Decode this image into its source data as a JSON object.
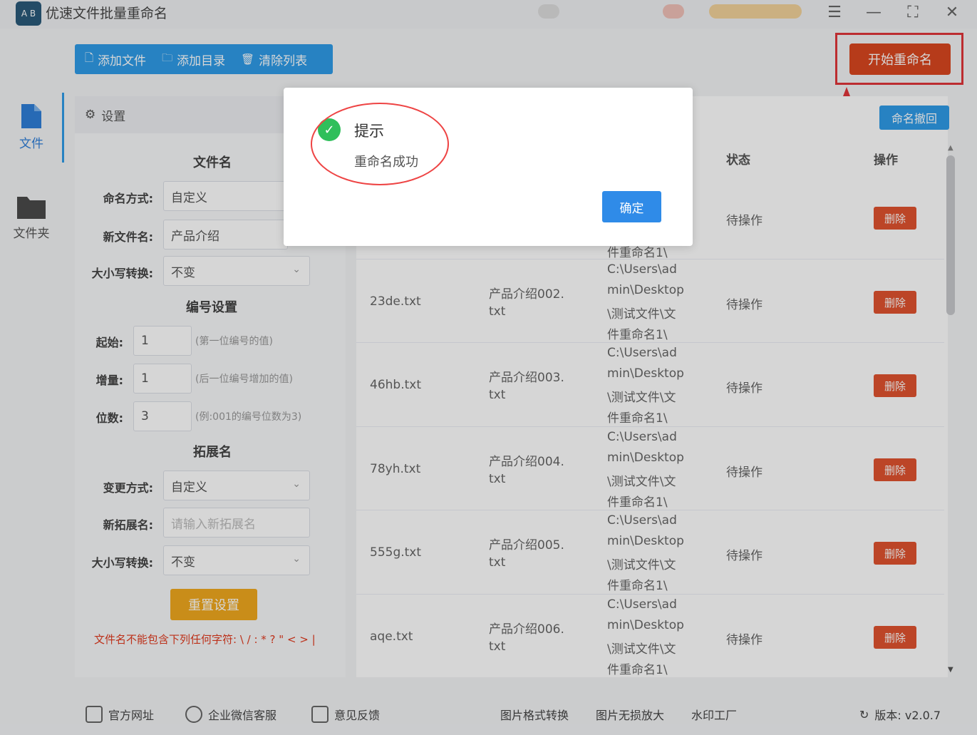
{
  "app": {
    "title": "优速文件批量重命名",
    "logo_text": "A B"
  },
  "toolbar": {
    "add_file": "添加文件",
    "add_dir": "添加目录",
    "clear_list": "清除列表",
    "start": "开始重命名",
    "undo": "命名撤回"
  },
  "nav": {
    "file": "文件",
    "folder": "文件夹"
  },
  "settings": {
    "header": "设置",
    "section_filename": "文件名",
    "naming_label": "命名方式:",
    "naming_value": "自定义",
    "newname_label": "新文件名:",
    "newname_value": "产品介绍",
    "case_label": "大小写转换:",
    "case_value": "不变",
    "section_number": "编号设置",
    "start_label": "起始:",
    "start_value": "1",
    "start_hint": "(第一位编号的值)",
    "inc_label": "增量:",
    "inc_value": "1",
    "inc_hint": "(后一位编号增加的值)",
    "digits_label": "位数:",
    "digits_value": "3",
    "digits_hint": "(例:001的编号位数为3)",
    "section_ext": "拓展名",
    "change_label": "变更方式:",
    "change_value": "自定义",
    "newext_label": "新拓展名:",
    "newext_placeholder": "请输入新拓展名",
    "case2_label": "大小写转换:",
    "case2_value": "不变",
    "reset": "重置设置",
    "warning": "文件名不能包含下列任何字符: \\ / : * ? \" < > |"
  },
  "table": {
    "headers": {
      "status": "状态",
      "op": "操作"
    },
    "partial_path_top": "件重命名1\\",
    "rows": [
      {
        "name": "",
        "new1": "",
        "new2": "",
        "path": [],
        "status": "待操作",
        "op": "删除"
      },
      {
        "name": "23de.txt",
        "new1": "产品介绍002.",
        "new2": "txt",
        "path": [
          "C:\\Users\\ad",
          "min\\Desktop",
          "\\测试文件\\文",
          "件重命名1\\"
        ],
        "status": "待操作",
        "op": "删除"
      },
      {
        "name": "46hb.txt",
        "new1": "产品介绍003.",
        "new2": "txt",
        "path": [
          "C:\\Users\\ad",
          "min\\Desktop",
          "\\测试文件\\文",
          "件重命名1\\"
        ],
        "status": "待操作",
        "op": "删除"
      },
      {
        "name": "78yh.txt",
        "new1": "产品介绍004.",
        "new2": "txt",
        "path": [
          "C:\\Users\\ad",
          "min\\Desktop",
          "\\测试文件\\文",
          "件重命名1\\"
        ],
        "status": "待操作",
        "op": "删除"
      },
      {
        "name": "555g.txt",
        "new1": "产品介绍005.",
        "new2": "txt",
        "path": [
          "C:\\Users\\ad",
          "min\\Desktop",
          "\\测试文件\\文",
          "件重命名1\\"
        ],
        "status": "待操作",
        "op": "删除"
      },
      {
        "name": "aqe.txt",
        "new1": "产品介绍006.",
        "new2": "txt",
        "path": [
          "C:\\Users\\ad",
          "min\\Desktop",
          "\\测试文件\\文",
          "件重命名1\\"
        ],
        "status": "待操作",
        "op": "删除"
      }
    ]
  },
  "footer": {
    "website": "官方网址",
    "wechat": "企业微信客服",
    "feedback": "意见反馈",
    "convert": "图片格式转换",
    "enlarge": "图片无损放大",
    "watermark": "水印工厂",
    "version": "版本: v2.0.7"
  },
  "dialog": {
    "title": "提示",
    "message": "重命名成功",
    "ok": "确定"
  },
  "colors": {
    "accent": "#2f9be8",
    "start": "#d9471f",
    "delete": "#e0532f",
    "reset": "#f0a81e",
    "success": "#2fbf5b",
    "annotation": "#e0353a"
  }
}
